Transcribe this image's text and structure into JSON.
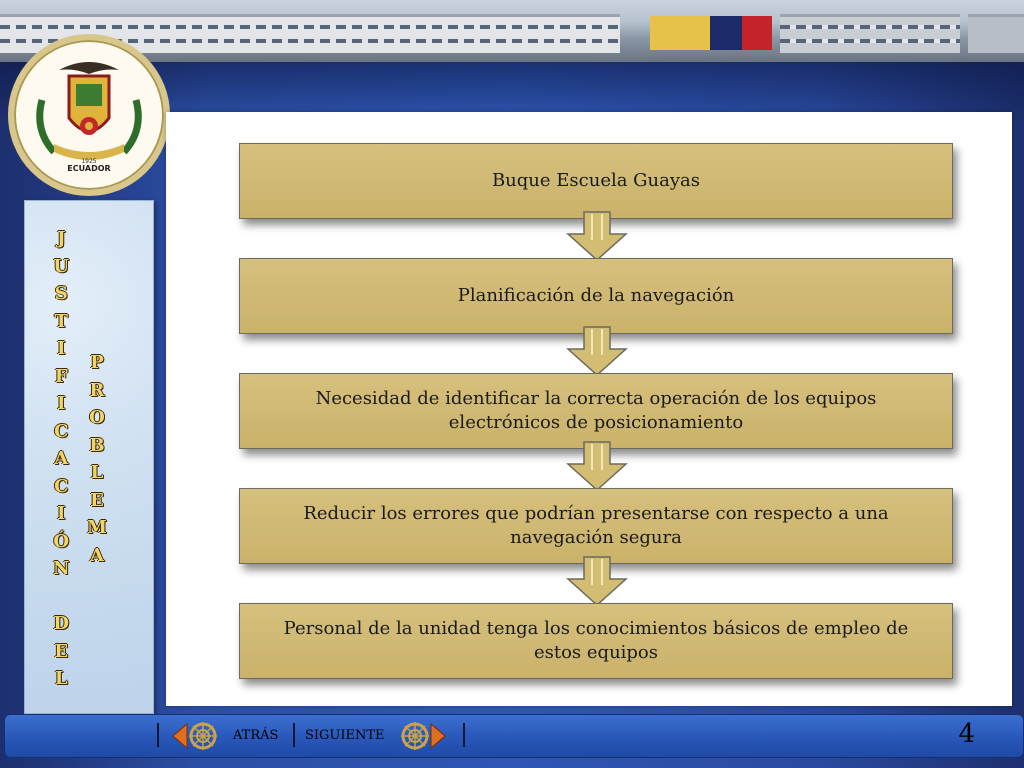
{
  "sidebar": {
    "word1": [
      "J",
      "U",
      "S",
      "T",
      "I",
      "F",
      "I",
      "C",
      "A",
      "C",
      "I",
      "Ó",
      "N",
      "",
      "D",
      "E",
      "L"
    ],
    "word2": [
      "P",
      "R",
      "O",
      "B",
      "L",
      "E",
      "M",
      "A"
    ]
  },
  "emblem": {
    "text": "ECUADOR",
    "year": "1925"
  },
  "flow": {
    "steps": [
      "Buque Escuela Guayas",
      "Planificación de la navegación",
      "Necesidad de identificar la correcta operación de los equipos electrónicos de posicionamiento",
      "Reducir los errores que podrían presentarse con respecto a una navegación segura",
      "Personal de la unidad tenga los conocimientos básicos de empleo de estos equipos"
    ]
  },
  "footer": {
    "back_label": "ATRÁS",
    "next_label": "SIGUIENTE",
    "page_number": "4"
  },
  "colors": {
    "step_fill": "#cdb670",
    "arrow_fill": "#d2bd73",
    "panel_letters": "#f1d46a",
    "footer_bar": "#2a59bc"
  }
}
